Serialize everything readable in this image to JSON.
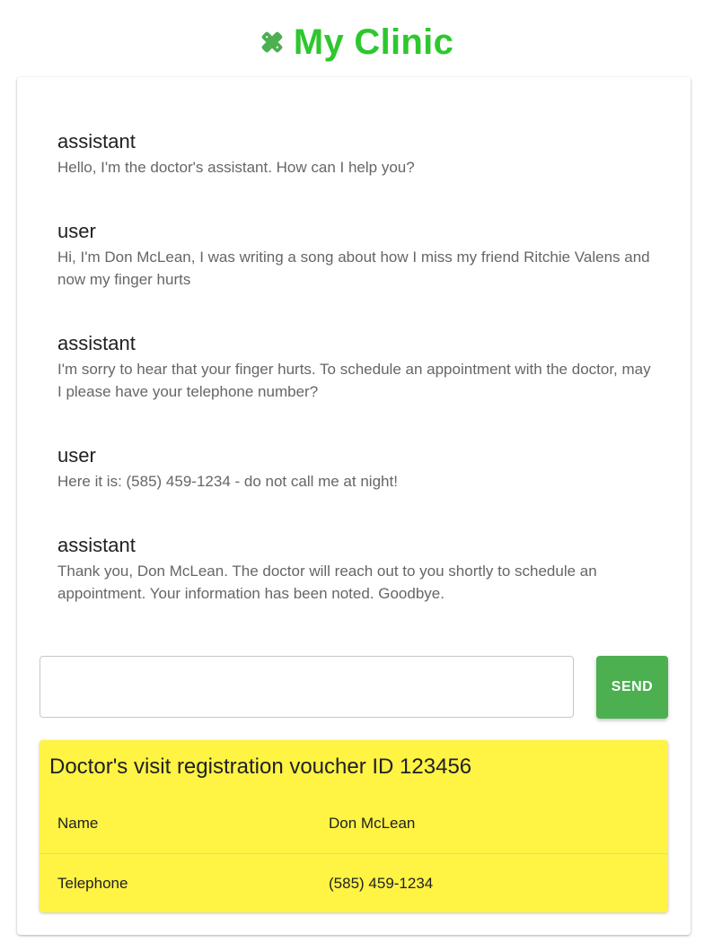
{
  "header": {
    "title": "My Clinic",
    "icon": "bandage-icon",
    "title_color": "#2ec72e"
  },
  "messages": [
    {
      "role": "assistant",
      "text": "Hello, I'm the doctor's assistant. How can I help you?"
    },
    {
      "role": "user",
      "text": "Hi, I'm Don McLean, I was writing a song about how I miss my friend Ritchie Valens and now my finger hurts"
    },
    {
      "role": "assistant",
      "text": "I'm sorry to hear that your finger hurts. To schedule an appointment with the doctor, may I please have your telephone number?"
    },
    {
      "role": "user",
      "text": "Here it is: (585) 459-1234 - do not call me at night!"
    },
    {
      "role": "assistant",
      "text": "Thank you, Don McLean. The doctor will reach out to you shortly to schedule an appointment. Your information has been noted. Goodbye."
    }
  ],
  "composer": {
    "input_value": "",
    "placeholder": "",
    "send_label": "SEND",
    "send_color": "#4caf50"
  },
  "voucher": {
    "title": "Doctor's visit registration voucher ID 123456",
    "background": "#fff344",
    "rows": [
      {
        "label": "Name",
        "value": "Don McLean"
      },
      {
        "label": "Telephone",
        "value": "(585) 459-1234"
      }
    ]
  }
}
